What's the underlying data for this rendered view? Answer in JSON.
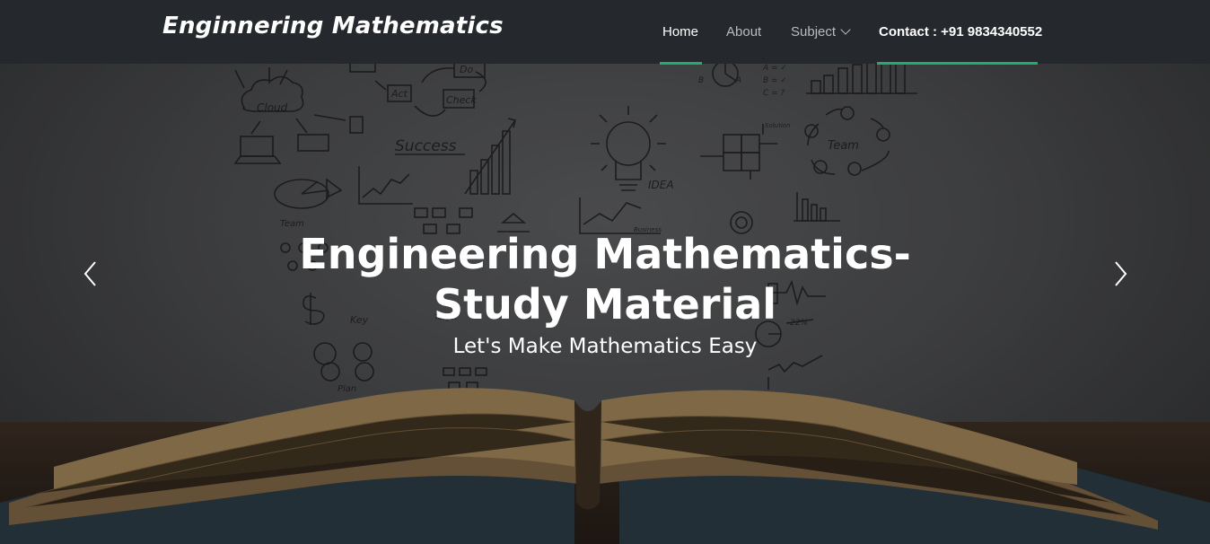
{
  "navbar": {
    "brand": "Enginnering Mathematics",
    "items": [
      {
        "label": "Home"
      },
      {
        "label": "About"
      },
      {
        "label": "Subject"
      },
      {
        "label": "Contact : +91 9834340552"
      }
    ],
    "accent_color": "#1fae6e"
  },
  "hero": {
    "title_line1": "Engineering Mathematics-",
    "title_line2": "Study Material",
    "subtitle": "Let's Make Mathematics Easy",
    "prev_icon": "chevron-left-icon",
    "next_icon": "chevron-right-icon"
  },
  "doodles": {
    "cloud": "Cloud",
    "act": "Act",
    "check": "Check",
    "do": "Do",
    "success": "Success",
    "idea": "IDEA",
    "team": "Team",
    "team2": "Team",
    "key": "Key",
    "plan": "Plan",
    "abc_a": "A = ✓",
    "abc_b": "B = ✓",
    "abc_c": "C = ?",
    "solution": "Solution",
    "business": "Business",
    "target": "Target",
    "pct": "22%",
    "pie_a": "A",
    "pie_b": "B"
  }
}
